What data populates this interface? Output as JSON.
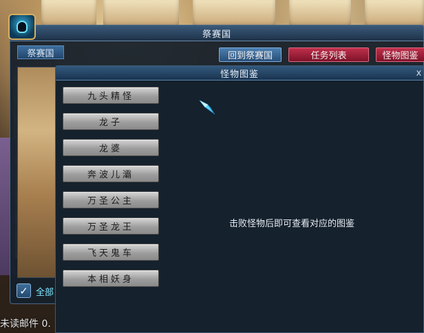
{
  "outer_window": {
    "title": "祭赛国",
    "sub_label": "祭赛国",
    "nav_buttons": [
      {
        "label": "回到祭赛国",
        "style": "blue"
      },
      {
        "label": "任务列表",
        "style": "red"
      },
      {
        "label": "怪物图鉴",
        "style": "red"
      }
    ],
    "checkbox_label": "全部",
    "checkbox_checked": true
  },
  "inner_window": {
    "title": "怪物图鉴",
    "close_glyph": "x",
    "monsters": [
      "九头精怪",
      "龙子",
      "龙婆",
      "奔波儿灞",
      "万圣公主",
      "万圣龙王",
      "飞天鬼车",
      "本相妖身"
    ],
    "hint": "击败怪物后即可查看对应的图鉴"
  },
  "status": {
    "mail_text": "未读邮件 0."
  },
  "icons": {
    "avatar": "skull-avatar-icon",
    "cursor": "crystal-cursor-icon",
    "check": "checkmark-icon"
  },
  "colors": {
    "blue_button": "#3a6a9a",
    "red_button": "#a0203c",
    "check_label": "#7fe8ff"
  }
}
